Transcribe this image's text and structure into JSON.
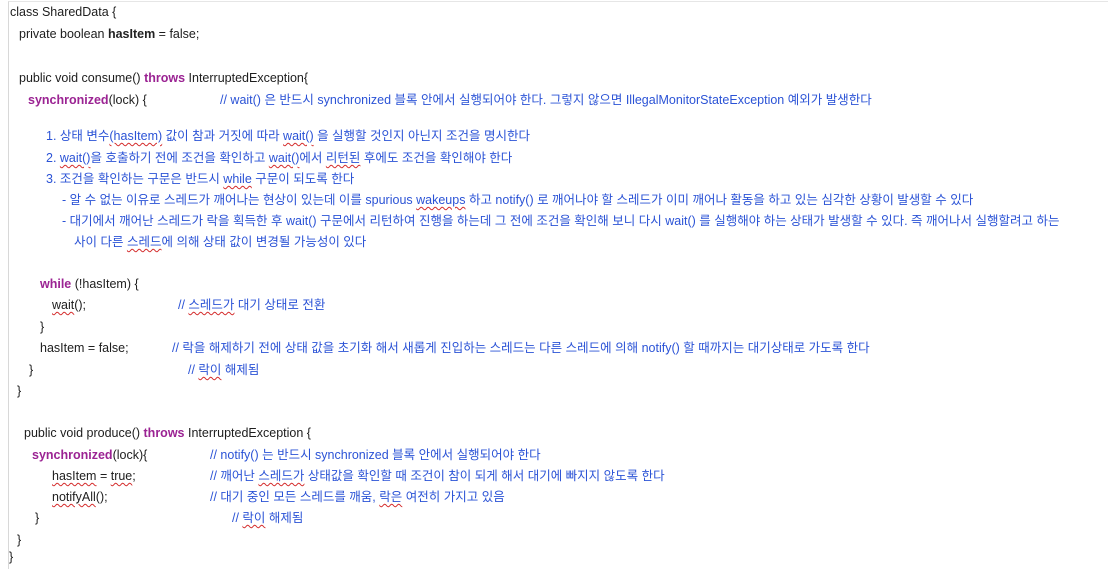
{
  "code": {
    "class_decl": "class SharedData {",
    "field": {
      "prefix": "private boolean ",
      "name": "hasItem",
      "suffix": " = false;"
    },
    "consume": {
      "sig_prefix": "public void consume() ",
      "throws_kw": "throws",
      "sig_suffix": " InterruptedException{",
      "sync_kw": "synchronized",
      "sync_suffix": "(lock) {",
      "sync_comment": "// wait() 은 반드시 synchronized 블록 안에서 실행되어야 한다. 그렇지 않으면 IllegalMonitorStateException 예외가 발생한다",
      "note1": {
        "a": "1. 상태 변수",
        "b": "(hasItem)",
        "c": " 값이 참과 거짓에 따라 ",
        "d": "wait()",
        "e": " 을 실행할 것인지 아닌지 조건을 명시한다"
      },
      "note2": {
        "a": "2. ",
        "b": "wait()",
        "c": "을 호출하기 전에 조건을 확인하고 ",
        "d": "wait()",
        "e": "에서 ",
        "f": "리턴된",
        "g": " 후에도 조건을 확인해야 한다"
      },
      "note3": {
        "a": "3. 조건을 확인하는 구문은 반드시 ",
        "b": "while",
        "c": " 구문이 되도록 한다"
      },
      "note4": {
        "a": "- 알 수 없는 이유로 스레드가 깨어나는 현상이 있는데 이를 spurious ",
        "b": "wakeups",
        "c": " 하고 notify() 로 깨어나야 할 스레드가 이미 깨어나 활동을 하고 있는 심각한 상황이 발생할 수 있다"
      },
      "note5": "- 대기에서 깨어난 스레드가 락을 획득한 후 wait() 구문에서 리턴하여 진행을 하는데 그 전에 조건을 확인해 보니 다시 wait() 를 실행해야 하는 상태가 발생할 수 있다. 즉 깨어나서 실행할려고 하는",
      "note6": {
        "a": "사이 다른 ",
        "b": "스레드",
        "c": "에 의해 상태 값이 변경될 가능성이 있다"
      },
      "while_kw": "while",
      "while_suffix": " (!hasItem) {",
      "wait_call": "wait",
      "wait_suffix": "();",
      "wait_comment": {
        "a": "// ",
        "b": "스레드가",
        "c": " 대기 상태로 전환"
      },
      "while_close": "}",
      "reset": "hasItem = false;",
      "reset_comment": "// 락을 해제하기 전에 상태 값을 초기화 해서 새롭게 진입하는 스레드는 다른 스레드에 의해 notify() 할 때까지는 대기상태로 가도록 한다",
      "sync_close": "}",
      "release_comment": {
        "a": "// ",
        "b": "락이",
        "c": " 해제됨"
      },
      "method_close": "}"
    },
    "produce": {
      "sig_prefix": "public void produce() ",
      "throws_kw": "throws",
      "sig_suffix": " InterruptedException {",
      "sync_kw": "synchronized",
      "sync_suffix": "(lock){",
      "sync_comment": "// notify() 는 반드시 synchronized 블록 안에서 실행되어야 한다",
      "set_a": "hasItem",
      "set_b": " = ",
      "set_c": "true",
      "set_d": ";",
      "set_comment": {
        "a": "// 깨어난 ",
        "b": "스레드가",
        "c": " 상태값을 확인할 때 조건이 참이 되게 해서 대기에 빠지지 않도록 한다"
      },
      "notify_a": "notifyAll",
      "notify_b": "();",
      "notify_comment": {
        "a": "// 대기 중인 모든 스레드를 깨움, ",
        "b": "락은",
        "c": " 여전히 가지고 있음"
      },
      "sync_close": "}",
      "release_comment": {
        "a": "// ",
        "b": "락이",
        "c": " 해제됨"
      },
      "method_close": "}"
    },
    "class_close": "}"
  },
  "colors": {
    "keyword": "#9b2393",
    "comment": "#2b53d6",
    "spellcheck": "#d42b2b"
  }
}
